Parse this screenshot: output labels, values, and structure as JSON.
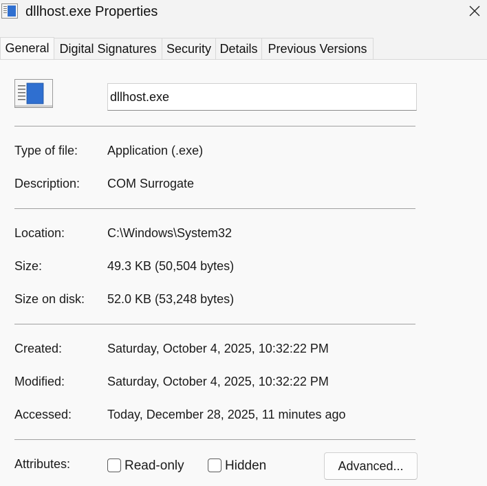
{
  "window": {
    "title": "dllhost.exe Properties",
    "close_glyph": "✕"
  },
  "tabs": [
    {
      "label": "General",
      "active": true
    },
    {
      "label": "Digital Signatures",
      "active": false
    },
    {
      "label": "Security",
      "active": false
    },
    {
      "label": "Details",
      "active": false
    },
    {
      "label": "Previous Versions",
      "active": false
    }
  ],
  "general": {
    "file_name": "dllhost.exe",
    "type_label": "Type of file:",
    "type_value": "Application (.exe)",
    "description_label": "Description:",
    "description_value": "COM Surrogate",
    "location_label": "Location:",
    "location_value": "C:\\Windows\\System32",
    "size_label": "Size:",
    "size_value": "49.3 KB (50,504 bytes)",
    "size_on_disk_label": "Size on disk:",
    "size_on_disk_value": "52.0 KB (53,248 bytes)",
    "created_label": "Created:",
    "created_value": "Saturday, October 4, 2025, 10:32:22 PM",
    "modified_label": "Modified:",
    "modified_value": "Saturday, October 4, 2025, 10:32:22 PM",
    "accessed_label": "Accessed:",
    "accessed_value": "Today, December 28, 2025, 11 minutes ago",
    "attributes_label": "Attributes:",
    "readonly_label": "Read-only",
    "readonly_checked": false,
    "hidden_label": "Hidden",
    "hidden_checked": false,
    "advanced_label": "Advanced..."
  },
  "icons": {
    "title": "application-window-icon",
    "file": "application-file-icon",
    "close": "close-icon"
  },
  "colors": {
    "icon_blue": "#2f6fd0",
    "background": "#f9f9f9",
    "titlebar": "#f3f3f3",
    "divider": "#a0a0a0"
  }
}
